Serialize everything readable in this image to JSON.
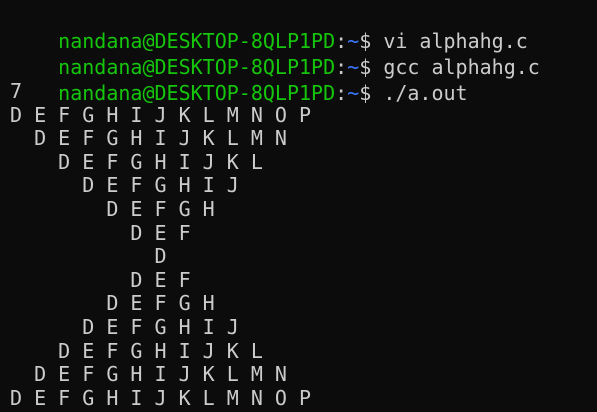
{
  "terminal": {
    "colors": {
      "background": "#0c0c0c",
      "text": "#cccccc",
      "user_host": "#16c60c",
      "path": "#3b78ff"
    },
    "prompt": {
      "user_host": "nandana@DESKTOP-8QLP1PD",
      "separator": ":",
      "path": "~",
      "symbol": "$"
    },
    "commands": [
      "vi alphahg.c",
      "gcc alphahg.c",
      "./a.out"
    ],
    "output": [
      "7",
      "D E F G H I J K L M N O P",
      "  D E F G H I J K L M N",
      "    D E F G H I J K L",
      "      D E F G H I J",
      "        D E F G H",
      "          D E F",
      "            D",
      "          D E F",
      "        D E F G H",
      "      D E F G H I J",
      "    D E F G H I J K L",
      "  D E F G H I J K L M N",
      "D E F G H I J K L M N O P"
    ]
  }
}
